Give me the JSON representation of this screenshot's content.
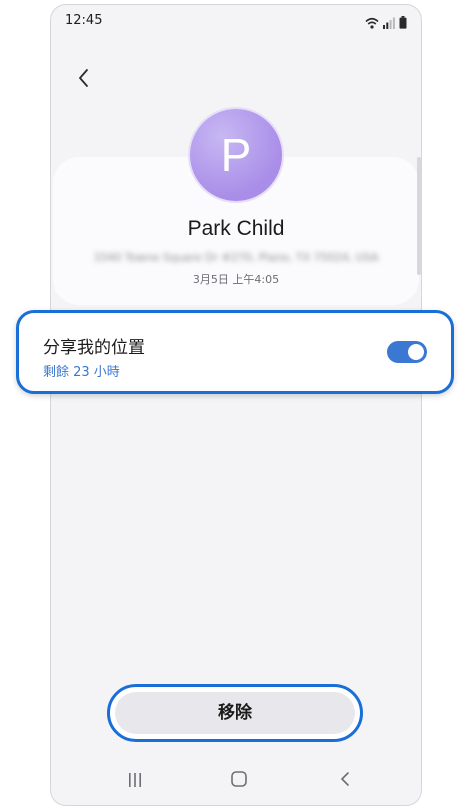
{
  "status_bar": {
    "time": "12:45"
  },
  "icons": {
    "wifi": "wifi-icon",
    "signal": "signal-icon",
    "battery": "battery-icon",
    "back": "chevron-left-icon",
    "recents": "recents-icon",
    "home": "home-icon",
    "nav_back": "nav-back-icon"
  },
  "profile": {
    "avatar_letter": "P",
    "name": "Park Child",
    "address": "3340 Towne Square Dr #270, Plano, TX 75024, USA",
    "timestamp": "3月5日 上午4:05"
  },
  "location_sharing": {
    "title": "分享我的位置",
    "remaining": "剩餘 23 小時",
    "enabled": true
  },
  "actions": {
    "remove_label": "移除"
  },
  "colors": {
    "accent": "#3a78d2",
    "highlight": "#1a6ed8",
    "avatar": "#a98de8"
  }
}
